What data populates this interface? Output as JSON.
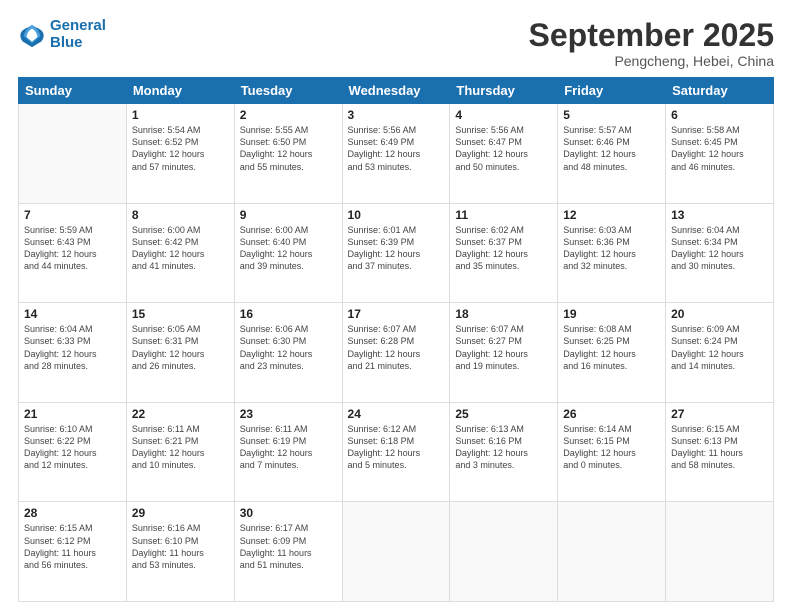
{
  "logo": {
    "line1": "General",
    "line2": "Blue"
  },
  "title": "September 2025",
  "location": "Pengcheng, Hebei, China",
  "weekdays": [
    "Sunday",
    "Monday",
    "Tuesday",
    "Wednesday",
    "Thursday",
    "Friday",
    "Saturday"
  ],
  "weeks": [
    [
      {
        "day": "",
        "info": ""
      },
      {
        "day": "1",
        "info": "Sunrise: 5:54 AM\nSunset: 6:52 PM\nDaylight: 12 hours\nand 57 minutes."
      },
      {
        "day": "2",
        "info": "Sunrise: 5:55 AM\nSunset: 6:50 PM\nDaylight: 12 hours\nand 55 minutes."
      },
      {
        "day": "3",
        "info": "Sunrise: 5:56 AM\nSunset: 6:49 PM\nDaylight: 12 hours\nand 53 minutes."
      },
      {
        "day": "4",
        "info": "Sunrise: 5:56 AM\nSunset: 6:47 PM\nDaylight: 12 hours\nand 50 minutes."
      },
      {
        "day": "5",
        "info": "Sunrise: 5:57 AM\nSunset: 6:46 PM\nDaylight: 12 hours\nand 48 minutes."
      },
      {
        "day": "6",
        "info": "Sunrise: 5:58 AM\nSunset: 6:45 PM\nDaylight: 12 hours\nand 46 minutes."
      }
    ],
    [
      {
        "day": "7",
        "info": "Sunrise: 5:59 AM\nSunset: 6:43 PM\nDaylight: 12 hours\nand 44 minutes."
      },
      {
        "day": "8",
        "info": "Sunrise: 6:00 AM\nSunset: 6:42 PM\nDaylight: 12 hours\nand 41 minutes."
      },
      {
        "day": "9",
        "info": "Sunrise: 6:00 AM\nSunset: 6:40 PM\nDaylight: 12 hours\nand 39 minutes."
      },
      {
        "day": "10",
        "info": "Sunrise: 6:01 AM\nSunset: 6:39 PM\nDaylight: 12 hours\nand 37 minutes."
      },
      {
        "day": "11",
        "info": "Sunrise: 6:02 AM\nSunset: 6:37 PM\nDaylight: 12 hours\nand 35 minutes."
      },
      {
        "day": "12",
        "info": "Sunrise: 6:03 AM\nSunset: 6:36 PM\nDaylight: 12 hours\nand 32 minutes."
      },
      {
        "day": "13",
        "info": "Sunrise: 6:04 AM\nSunset: 6:34 PM\nDaylight: 12 hours\nand 30 minutes."
      }
    ],
    [
      {
        "day": "14",
        "info": "Sunrise: 6:04 AM\nSunset: 6:33 PM\nDaylight: 12 hours\nand 28 minutes."
      },
      {
        "day": "15",
        "info": "Sunrise: 6:05 AM\nSunset: 6:31 PM\nDaylight: 12 hours\nand 26 minutes."
      },
      {
        "day": "16",
        "info": "Sunrise: 6:06 AM\nSunset: 6:30 PM\nDaylight: 12 hours\nand 23 minutes."
      },
      {
        "day": "17",
        "info": "Sunrise: 6:07 AM\nSunset: 6:28 PM\nDaylight: 12 hours\nand 21 minutes."
      },
      {
        "day": "18",
        "info": "Sunrise: 6:07 AM\nSunset: 6:27 PM\nDaylight: 12 hours\nand 19 minutes."
      },
      {
        "day": "19",
        "info": "Sunrise: 6:08 AM\nSunset: 6:25 PM\nDaylight: 12 hours\nand 16 minutes."
      },
      {
        "day": "20",
        "info": "Sunrise: 6:09 AM\nSunset: 6:24 PM\nDaylight: 12 hours\nand 14 minutes."
      }
    ],
    [
      {
        "day": "21",
        "info": "Sunrise: 6:10 AM\nSunset: 6:22 PM\nDaylight: 12 hours\nand 12 minutes."
      },
      {
        "day": "22",
        "info": "Sunrise: 6:11 AM\nSunset: 6:21 PM\nDaylight: 12 hours\nand 10 minutes."
      },
      {
        "day": "23",
        "info": "Sunrise: 6:11 AM\nSunset: 6:19 PM\nDaylight: 12 hours\nand 7 minutes."
      },
      {
        "day": "24",
        "info": "Sunrise: 6:12 AM\nSunset: 6:18 PM\nDaylight: 12 hours\nand 5 minutes."
      },
      {
        "day": "25",
        "info": "Sunrise: 6:13 AM\nSunset: 6:16 PM\nDaylight: 12 hours\nand 3 minutes."
      },
      {
        "day": "26",
        "info": "Sunrise: 6:14 AM\nSunset: 6:15 PM\nDaylight: 12 hours\nand 0 minutes."
      },
      {
        "day": "27",
        "info": "Sunrise: 6:15 AM\nSunset: 6:13 PM\nDaylight: 11 hours\nand 58 minutes."
      }
    ],
    [
      {
        "day": "28",
        "info": "Sunrise: 6:15 AM\nSunset: 6:12 PM\nDaylight: 11 hours\nand 56 minutes."
      },
      {
        "day": "29",
        "info": "Sunrise: 6:16 AM\nSunset: 6:10 PM\nDaylight: 11 hours\nand 53 minutes."
      },
      {
        "day": "30",
        "info": "Sunrise: 6:17 AM\nSunset: 6:09 PM\nDaylight: 11 hours\nand 51 minutes."
      },
      {
        "day": "",
        "info": ""
      },
      {
        "day": "",
        "info": ""
      },
      {
        "day": "",
        "info": ""
      },
      {
        "day": "",
        "info": ""
      }
    ]
  ]
}
